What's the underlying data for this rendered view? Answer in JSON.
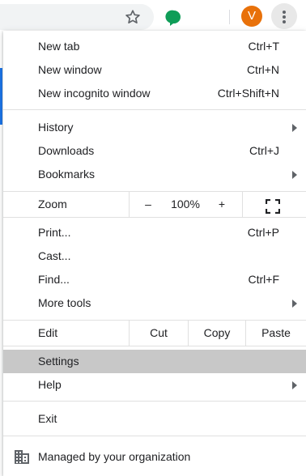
{
  "toolbar": {
    "profile_initial": "V",
    "colors": {
      "avatar": "#e8710a",
      "extension": "#0f9d58",
      "accent": "#1a73e8"
    },
    "icons": [
      "star-icon",
      "extension-icon",
      "more-vert-icon"
    ]
  },
  "menu": {
    "new_tab": {
      "label": "New tab",
      "shortcut": "Ctrl+T"
    },
    "new_window": {
      "label": "New window",
      "shortcut": "Ctrl+N"
    },
    "new_incognito": {
      "label": "New incognito window",
      "shortcut": "Ctrl+Shift+N"
    },
    "history": {
      "label": "History"
    },
    "downloads": {
      "label": "Downloads",
      "shortcut": "Ctrl+J"
    },
    "bookmarks": {
      "label": "Bookmarks"
    },
    "zoom": {
      "label": "Zoom",
      "minus": "–",
      "value": "100%",
      "plus": "+"
    },
    "print": {
      "label": "Print...",
      "shortcut": "Ctrl+P"
    },
    "cast": {
      "label": "Cast..."
    },
    "find": {
      "label": "Find...",
      "shortcut": "Ctrl+F"
    },
    "more_tools": {
      "label": "More tools"
    },
    "edit": {
      "label": "Edit",
      "cut": "Cut",
      "copy": "Copy",
      "paste": "Paste"
    },
    "settings": {
      "label": "Settings"
    },
    "help": {
      "label": "Help"
    },
    "exit": {
      "label": "Exit"
    },
    "managed": {
      "label": "Managed by your organization"
    }
  }
}
